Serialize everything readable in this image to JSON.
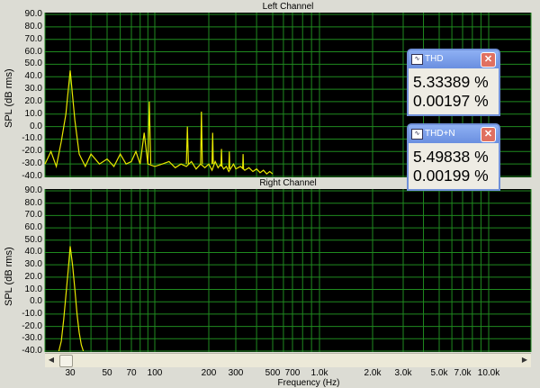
{
  "left_channel": {
    "title": "Left Channel"
  },
  "right_channel": {
    "title": "Right Channel"
  },
  "y_axis_label": "SPL (dB rms)",
  "x_axis_label": "Frequency (Hz)",
  "y_ticks": [
    "90.0",
    "80.0",
    "70.0",
    "60.0",
    "50.0",
    "40.0",
    "30.0",
    "20.0",
    "10.0",
    "0.0",
    "-10.0",
    "-20.0",
    "-30.0",
    "-40.0"
  ],
  "x_ticks": [
    "30",
    "50",
    "70",
    "100",
    "200",
    "300",
    "500",
    "700",
    "1.0k",
    "2.0k",
    "3.0k",
    "5.0k",
    "7.0k",
    "10.0k"
  ],
  "colors": {
    "plot_bg": "#000000",
    "grid": "#1f8a1f",
    "trace": "#e8e800",
    "panel": "#dcdcd4"
  },
  "thd_window": {
    "title": "THD",
    "value_percent": "5.33389 %",
    "value_second": "0.00197 %",
    "icon": "app-icon",
    "close_icon": "close-icon"
  },
  "thdn_window": {
    "title": "THD+N",
    "value_percent": "5.49838 %",
    "value_second": "0.00199 %",
    "icon": "app-icon",
    "close_icon": "close-icon"
  },
  "scrollbar": {
    "left_icon": "scroll-left-icon",
    "right_icon": "scroll-right-icon"
  },
  "chart_data": [
    {
      "type": "line",
      "title": "Left Channel",
      "xlabel": "Frequency (Hz)",
      "ylabel": "SPL (dB rms)",
      "x_scale": "log",
      "xlim": [
        20,
        20000
      ],
      "ylim": [
        -40,
        90
      ],
      "grid": true,
      "series": [
        {
          "points": [
            [
              20,
              -30
            ],
            [
              22,
              -20
            ],
            [
              24,
              -32
            ],
            [
              26,
              -12
            ],
            [
              28,
              10
            ],
            [
              30,
              45
            ],
            [
              32,
              5
            ],
            [
              34,
              -22
            ],
            [
              37,
              -32
            ],
            [
              40,
              -22
            ],
            [
              45,
              -30
            ],
            [
              50,
              -26
            ],
            [
              55,
              -32
            ],
            [
              60,
              -22
            ],
            [
              65,
              -30
            ],
            [
              70,
              -28
            ],
            [
              75,
              -20
            ],
            [
              80,
              -30
            ],
            [
              85,
              -5
            ],
            [
              90,
              -30
            ],
            [
              100,
              -32
            ],
            [
              110,
              -30
            ],
            [
              120,
              -28
            ],
            [
              130,
              -33
            ],
            [
              140,
              -30
            ],
            [
              150,
              -32
            ],
            [
              160,
              -28
            ],
            [
              170,
              -34
            ],
            [
              180,
              -30
            ],
            [
              190,
              -33
            ],
            [
              200,
              -30
            ],
            [
              210,
              -35
            ],
            [
              220,
              -28
            ],
            [
              230,
              -33
            ],
            [
              240,
              -30
            ],
            [
              250,
              -34
            ],
            [
              260,
              -32
            ],
            [
              270,
              -36
            ],
            [
              290,
              -30
            ],
            [
              300,
              -34
            ],
            [
              320,
              -32
            ],
            [
              340,
              -35
            ],
            [
              360,
              -33
            ],
            [
              380,
              -36
            ],
            [
              400,
              -34
            ],
            [
              420,
              -37
            ],
            [
              440,
              -35
            ],
            [
              460,
              -38
            ],
            [
              480,
              -36
            ],
            [
              500,
              -38
            ]
          ]
        },
        {
          "points": [
            [
              90,
              -30
            ],
            [
              92,
              20
            ],
            [
              94,
              -30
            ]
          ]
        },
        {
          "points": [
            [
              150,
              -30
            ],
            [
              152,
              0
            ],
            [
              154,
              -30
            ]
          ]
        },
        {
          "points": [
            [
              180,
              -30
            ],
            [
              182,
              12
            ],
            [
              184,
              -30
            ]
          ]
        },
        {
          "points": [
            [
              210,
              -30
            ],
            [
              212,
              -5
            ],
            [
              214,
              -30
            ]
          ]
        },
        {
          "points": [
            [
              240,
              -32
            ],
            [
              242,
              -18
            ],
            [
              244,
              -32
            ]
          ]
        },
        {
          "points": [
            [
              270,
              -34
            ],
            [
              272,
              -20
            ],
            [
              274,
              -34
            ]
          ]
        },
        {
          "points": [
            [
              330,
              -34
            ],
            [
              332,
              -22
            ],
            [
              334,
              -34
            ]
          ]
        }
      ]
    },
    {
      "type": "line",
      "title": "Right Channel",
      "xlabel": "Frequency (Hz)",
      "ylabel": "SPL (dB rms)",
      "x_scale": "log",
      "xlim": [
        20,
        20000
      ],
      "ylim": [
        -40,
        90
      ],
      "grid": true,
      "series": [
        {
          "points": [
            [
              25,
              -40
            ],
            [
              26,
              -32
            ],
            [
              27,
              -15
            ],
            [
              28,
              5
            ],
            [
              29,
              25
            ],
            [
              30,
              45
            ],
            [
              31,
              30
            ],
            [
              32,
              10
            ],
            [
              33,
              -10
            ],
            [
              34,
              -25
            ],
            [
              35,
              -35
            ],
            [
              36,
              -40
            ]
          ]
        }
      ]
    }
  ]
}
